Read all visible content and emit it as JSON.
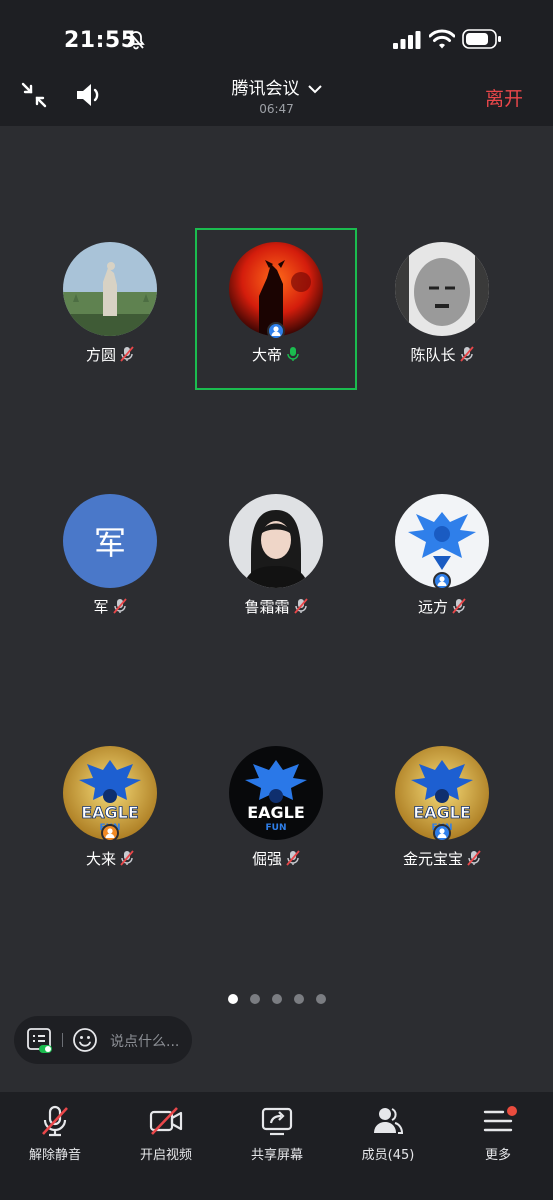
{
  "status_bar": {
    "time": "21:55"
  },
  "header": {
    "title": "腾讯会议",
    "timer": "06:47",
    "leave_label": "离开"
  },
  "participants": [
    {
      "name": "方圆",
      "muted": true
    },
    {
      "name": "大帝",
      "muted": false,
      "speaking": true
    },
    {
      "name": "陈队长",
      "muted": true
    },
    {
      "name": "军",
      "avatar_text": "军",
      "muted": true
    },
    {
      "name": "鲁霜霜",
      "muted": true
    },
    {
      "name": "远方",
      "muted": true
    },
    {
      "name": "大来",
      "muted": true
    },
    {
      "name": "倔强",
      "muted": true
    },
    {
      "name": "金元宝宝",
      "muted": true
    }
  ],
  "logo_text": {
    "eagle": "EAGLE",
    "fun": "FUN"
  },
  "pager": {
    "pages": 5,
    "current": 1
  },
  "chat": {
    "placeholder": "说点什么..."
  },
  "toolbar": {
    "unmute": "解除静音",
    "start_video": "开启视频",
    "share_screen": "共享屏幕",
    "members": "成员(45)",
    "more": "更多"
  },
  "colors": {
    "background": "#2c2d31",
    "bar": "#1e1f23",
    "leave": "#e9474a",
    "active_speaker_border": "#1bbc4f",
    "host_badge": "#2f7fea",
    "notification_dot": "#ea4c3e"
  }
}
